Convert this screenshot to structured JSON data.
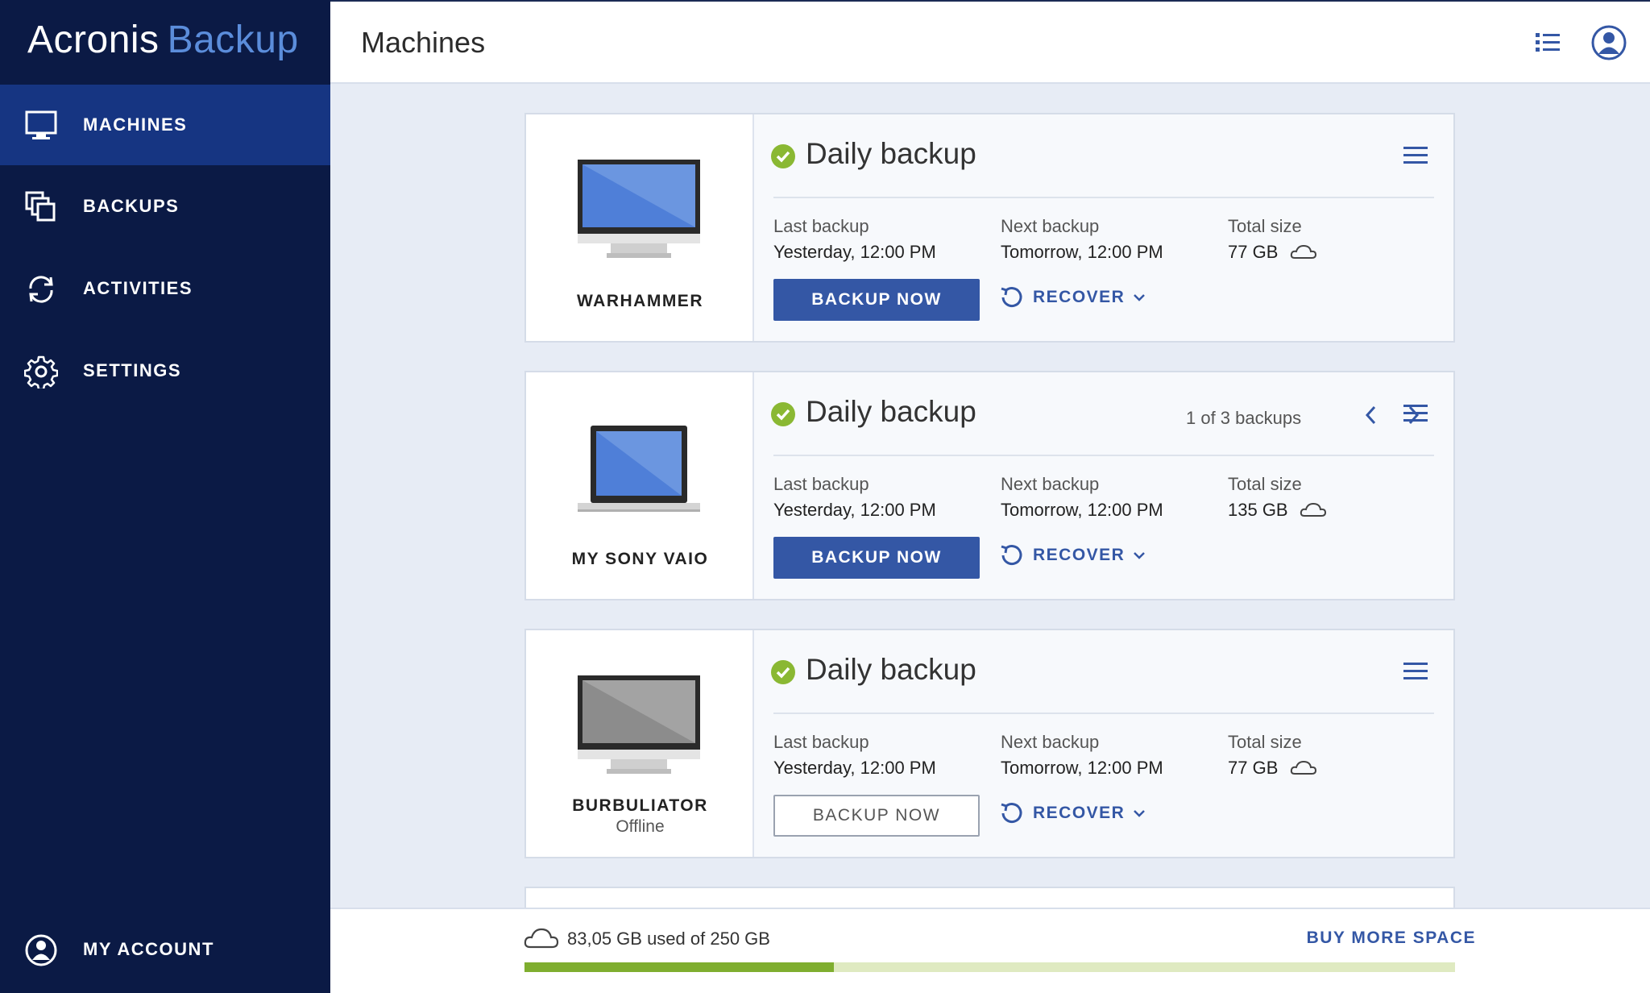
{
  "app": {
    "brand_primary": "Acronis",
    "brand_secondary": "Backup"
  },
  "sidebar": {
    "items": [
      {
        "label": "MACHINES",
        "icon": "monitor-icon",
        "active": true
      },
      {
        "label": "BACKUPS",
        "icon": "backups-icon",
        "active": false
      },
      {
        "label": "ACTIVITIES",
        "icon": "activities-icon",
        "active": false
      },
      {
        "label": "SETTINGS",
        "icon": "gear-icon",
        "active": false
      }
    ],
    "account": {
      "label": "MY ACCOUNT",
      "icon": "account-icon"
    }
  },
  "header": {
    "title": "Machines",
    "icons": [
      "list-view-icon",
      "user-icon"
    ]
  },
  "cards": [
    {
      "machine_name": "WARHAMMER",
      "machine_status": "",
      "machine_type": "desktop",
      "plan_name": "Daily backup",
      "pager": "",
      "last_backup_label": "Last backup",
      "last_backup_value": "Yesterday, 12:00 PM",
      "next_backup_label": "Next backup",
      "next_backup_value": "Tomorrow, 12:00 PM",
      "total_size_label": "Total size",
      "total_size_value": "77 GB",
      "backup_now_label": "BACKUP NOW",
      "recover_label": "RECOVER"
    },
    {
      "machine_name": "MY SONY VAIO",
      "machine_status": "",
      "machine_type": "laptop",
      "plan_name": "Daily backup",
      "pager": "1 of 3 backups",
      "last_backup_label": "Last backup",
      "last_backup_value": "Yesterday, 12:00 PM",
      "next_backup_label": "Next backup",
      "next_backup_value": "Tomorrow, 12:00 PM",
      "total_size_label": "Total size",
      "total_size_value": "135 GB",
      "backup_now_label": "BACKUP NOW",
      "recover_label": "RECOVER"
    },
    {
      "machine_name": "BURBULIATOR",
      "machine_status": "Offline",
      "machine_type": "desktop-offline",
      "plan_name": "Daily backup",
      "pager": "",
      "last_backup_label": "Last backup",
      "last_backup_value": "Yesterday, 12:00 PM",
      "next_backup_label": "Next backup",
      "next_backup_value": "Tomorrow, 12:00 PM",
      "total_size_label": "Total size",
      "total_size_value": "77 GB",
      "backup_now_label": "BACKUP NOW",
      "recover_label": "RECOVER"
    }
  ],
  "storage": {
    "text": "83,05 GB used of 250 GB",
    "used_fraction": 0.3322,
    "buy_more_label": "BUY MORE SPACE"
  },
  "colors": {
    "sidebar_bg": "#0b1a45",
    "sidebar_active": "#163582",
    "accent_blue": "#3457a5",
    "status_green": "#8ab833",
    "storage_fill": "#7fae2f",
    "storage_track": "#dfeac1"
  }
}
